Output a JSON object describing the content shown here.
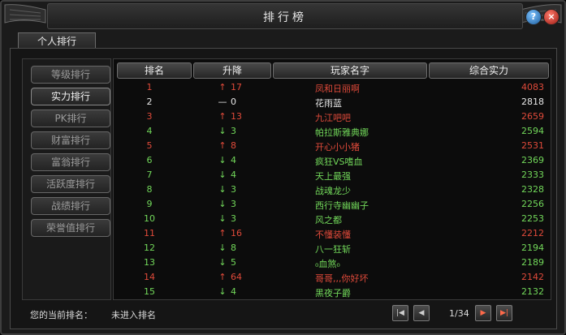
{
  "window": {
    "title": "排行榜",
    "help_label": "?",
    "close_label": "×"
  },
  "tab": {
    "label": "个人排行"
  },
  "sidebar": {
    "items": [
      {
        "label": "等级排行",
        "active": false
      },
      {
        "label": "实力排行",
        "active": true
      },
      {
        "label": "PK排行",
        "active": false
      },
      {
        "label": "财富排行",
        "active": false
      },
      {
        "label": "富翁排行",
        "active": false
      },
      {
        "label": "活跃度排行",
        "active": false
      },
      {
        "label": "战绩排行",
        "active": false
      },
      {
        "label": "荣誉值排行",
        "active": false
      }
    ]
  },
  "table": {
    "columns": [
      "排名",
      "升降",
      "玩家名字",
      "综合实力"
    ],
    "rows": [
      {
        "rank": "1",
        "arrow": "↑",
        "delta": "17",
        "name": "凤和日丽啊",
        "power": "4083",
        "color": "red",
        "dir": "up"
      },
      {
        "rank": "2",
        "arrow": "—",
        "delta": "0",
        "name": "花雨蓝",
        "power": "2818",
        "color": "white",
        "dir": "same"
      },
      {
        "rank": "3",
        "arrow": "↑",
        "delta": "13",
        "name": "九江吧吧",
        "power": "2659",
        "color": "red",
        "dir": "up"
      },
      {
        "rank": "4",
        "arrow": "↓",
        "delta": "3",
        "name": "帕拉斯雅典娜",
        "power": "2594",
        "color": "green",
        "dir": "down"
      },
      {
        "rank": "5",
        "arrow": "↑",
        "delta": "8",
        "name": "开心小小猪",
        "power": "2531",
        "color": "red",
        "dir": "up"
      },
      {
        "rank": "6",
        "arrow": "↓",
        "delta": "4",
        "name": "疯狂VS嗜血",
        "power": "2369",
        "color": "green",
        "dir": "down"
      },
      {
        "rank": "7",
        "arrow": "↓",
        "delta": "4",
        "name": "天上最强",
        "power": "2333",
        "color": "green",
        "dir": "down"
      },
      {
        "rank": "8",
        "arrow": "↓",
        "delta": "3",
        "name": "战魂龙少",
        "power": "2328",
        "color": "green",
        "dir": "down"
      },
      {
        "rank": "9",
        "arrow": "↓",
        "delta": "3",
        "name": "西行寺幽幽子",
        "power": "2256",
        "color": "green",
        "dir": "down"
      },
      {
        "rank": "10",
        "arrow": "↓",
        "delta": "3",
        "name": "风之都",
        "power": "2253",
        "color": "green",
        "dir": "down"
      },
      {
        "rank": "11",
        "arrow": "↑",
        "delta": "16",
        "name": "不懂装懂",
        "power": "2212",
        "color": "red",
        "dir": "up"
      },
      {
        "rank": "12",
        "arrow": "↓",
        "delta": "8",
        "name": "八一狂斩",
        "power": "2194",
        "color": "green",
        "dir": "down"
      },
      {
        "rank": "13",
        "arrow": "↓",
        "delta": "5",
        "name": "₀血煞₀",
        "power": "2189",
        "color": "green",
        "dir": "down"
      },
      {
        "rank": "14",
        "arrow": "↑",
        "delta": "64",
        "name": "哥哥,,,你好坏",
        "power": "2142",
        "color": "red",
        "dir": "up"
      },
      {
        "rank": "15",
        "arrow": "↓",
        "delta": "4",
        "name": "黑夜子爵",
        "power": "2132",
        "color": "green",
        "dir": "down"
      }
    ]
  },
  "footer": {
    "current_rank_label": "您的当前排名：",
    "current_rank_value": "未进入排名"
  },
  "pagination": {
    "info": "1/34",
    "first": "|◀",
    "prev": "◀",
    "next": "▶",
    "last": "▶|"
  },
  "colors": {
    "red": "#e04a3a",
    "green": "#72d85a",
    "white": "#e8e8e8"
  }
}
